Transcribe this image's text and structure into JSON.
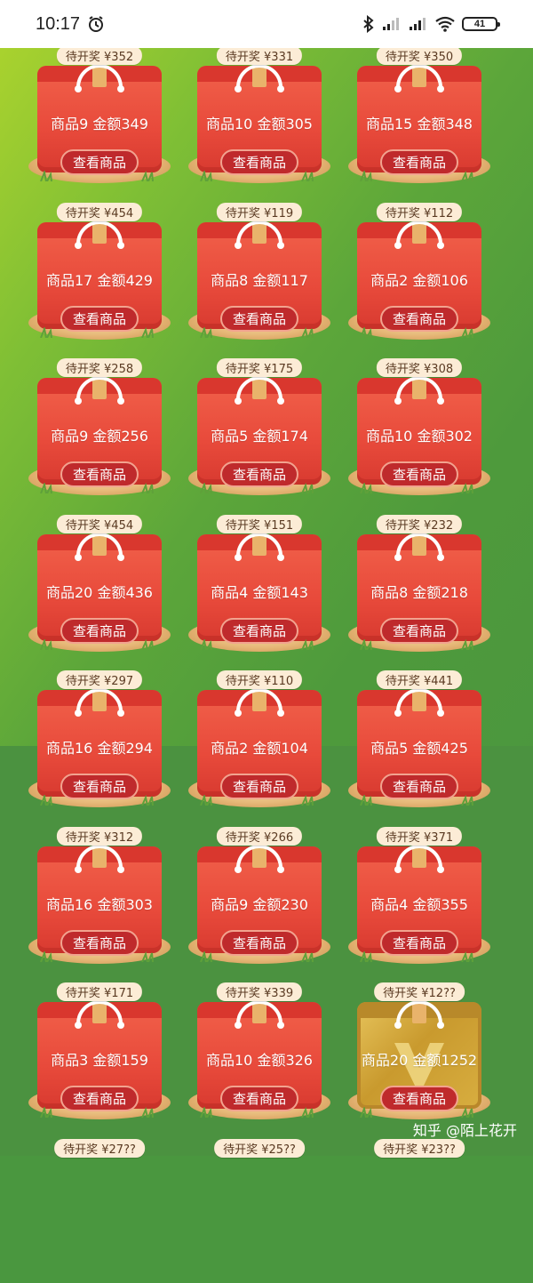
{
  "status_bar": {
    "time": "10:17",
    "battery_level": "41",
    "icons": [
      "alarm-icon",
      "bluetooth-icon",
      "signal-icon",
      "signal-icon",
      "wifi-icon",
      "battery-icon"
    ]
  },
  "colors": {
    "bag_red": "#e84a3b",
    "button_red": "#bf2a2c",
    "badge_bg": "#fcecd6",
    "background_green": "#4a973f"
  },
  "grid": {
    "items": [
      {
        "prize": "待开奖 ¥352",
        "label": "商品9 金额349",
        "button": "查看商品"
      },
      {
        "prize": "待开奖 ¥331",
        "label": "商品10 金额305",
        "button": "查看商品"
      },
      {
        "prize": "待开奖 ¥350",
        "label": "商品15 金额348",
        "button": "查看商品"
      },
      {
        "prize": "待开奖 ¥454",
        "label": "商品17 金额429",
        "button": "查看商品"
      },
      {
        "prize": "待开奖 ¥119",
        "label": "商品8 金额117",
        "button": "查看商品"
      },
      {
        "prize": "待开奖 ¥112",
        "label": "商品2 金额106",
        "button": "查看商品"
      },
      {
        "prize": "待开奖 ¥258",
        "label": "商品9 金额256",
        "button": "查看商品"
      },
      {
        "prize": "待开奖 ¥175",
        "label": "商品5 金额174",
        "button": "查看商品"
      },
      {
        "prize": "待开奖 ¥308",
        "label": "商品10 金额302",
        "button": "查看商品"
      },
      {
        "prize": "待开奖 ¥454",
        "label": "商品20 金额436",
        "button": "查看商品"
      },
      {
        "prize": "待开奖 ¥151",
        "label": "商品4 金额143",
        "button": "查看商品"
      },
      {
        "prize": "待开奖 ¥232",
        "label": "商品8 金额218",
        "button": "查看商品"
      },
      {
        "prize": "待开奖 ¥297",
        "label": "商品16 金额294",
        "button": "查看商品"
      },
      {
        "prize": "待开奖 ¥110",
        "label": "商品2 金额104",
        "button": "查看商品"
      },
      {
        "prize": "待开奖 ¥441",
        "label": "商品5 金额425",
        "button": "查看商品"
      },
      {
        "prize": "待开奖 ¥312",
        "label": "商品16 金额303",
        "button": "查看商品"
      },
      {
        "prize": "待开奖 ¥266",
        "label": "商品9 金额230",
        "button": "查看商品"
      },
      {
        "prize": "待开奖 ¥371",
        "label": "商品4 金额355",
        "button": "查看商品"
      },
      {
        "prize": "待开奖 ¥171",
        "label": "商品3 金额159",
        "button": "查看商品"
      },
      {
        "prize": "待开奖 ¥339",
        "label": "商品10 金额326",
        "button": "查看商品"
      },
      {
        "prize": "待开奖 ¥12??",
        "label": "商品20 金额1252",
        "button": "查看商品",
        "style": "gold"
      },
      {
        "prize": "待开奖 ¥27??"
      },
      {
        "prize": "待开奖 ¥25??"
      },
      {
        "prize": "待开奖 ¥23??"
      }
    ]
  },
  "watermark": "知乎 @陌上花开"
}
